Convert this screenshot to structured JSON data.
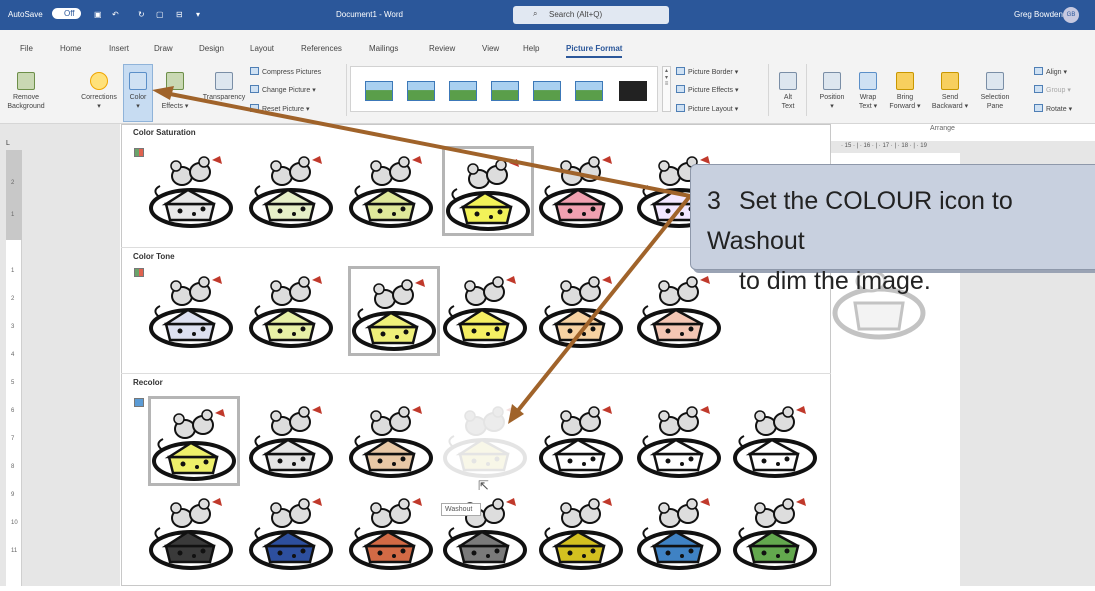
{
  "titlebar": {
    "autosave": "AutoSave",
    "toggle": "Off",
    "document": "Document1 - Word",
    "search": "Search (Alt+Q)",
    "user": "Greg Bowden",
    "initials": "GB"
  },
  "tabs": [
    "File",
    "Home",
    "Insert",
    "Draw",
    "Design",
    "Layout",
    "References",
    "Mailings",
    "Review",
    "View",
    "Help",
    "Picture Format"
  ],
  "ribbon": {
    "remove_bg": [
      "Remove",
      "Background"
    ],
    "corrections": "Corrections",
    "color": "Color",
    "artistic": "Effects",
    "transparency": "Transparency",
    "compress": "Compress Pictures",
    "change": "Change Picture",
    "reset": "Reset Picture",
    "border": "Picture Border",
    "effects": "Picture Effects",
    "layout": "Picture Layout",
    "alt": [
      "Alt",
      "Text"
    ],
    "position": "Position",
    "wrap": [
      "Wrap",
      "Text"
    ],
    "bring": [
      "Bring",
      "Forward"
    ],
    "send": [
      "Send",
      "Backward"
    ],
    "selection": [
      "Selection",
      "Pane"
    ],
    "align": "Align",
    "group": "Group",
    "rotate": "Rotate",
    "arrange": "Arrange"
  },
  "ruler": {
    "h": "· 15 · | · 16 · | · 17 · | · 18 · | · 19",
    "v": [
      "2",
      "1",
      "1",
      "2",
      "3",
      "4",
      "5",
      "6",
      "7",
      "8",
      "9",
      "10",
      "11"
    ]
  },
  "sections": {
    "saturation": "Color Saturation",
    "tone": "Color Tone",
    "recolor": "Recolor"
  },
  "tints": {
    "saturation": [
      "#e8e8e8",
      "#e6efc8",
      "#dfe89a",
      "#f2f259",
      "#f0a0b0",
      "#f3e7ff"
    ],
    "tone": [
      "#dde0f0",
      "#e7f0a6",
      "#eff07a",
      "#f6ef63",
      "#f7d2a2",
      "#f4c6b4"
    ],
    "recolor1": [
      "#eef06a",
      "#e5e5e5",
      "#e8c8a6",
      "#f4f2d6",
      "#ffffff",
      "#ffffff",
      "#ffffff"
    ],
    "recolor2": [
      "#3a3a3a",
      "#2d4f9e",
      "#d26a45",
      "#7a7a7a",
      "#d3c020",
      "#3f82c4",
      "#63a84e"
    ]
  },
  "tooltip": "Washout",
  "callout": {
    "step": "3",
    "line1": "Set the COLOUR icon to Washout",
    "line2": "to dim the image."
  }
}
